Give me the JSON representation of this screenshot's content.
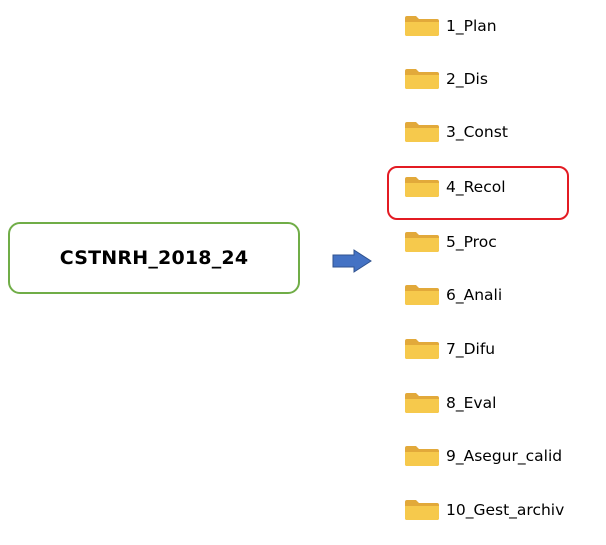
{
  "project": {
    "label": "CSTNRH_2018_24",
    "border_color": "#70ad47"
  },
  "arrow": {
    "icon": "arrow-right-icon",
    "color": "#4472c4"
  },
  "folder_icon": {
    "name": "folder-icon",
    "color": "#f6c94c"
  },
  "highlight": {
    "color": "#e31b23",
    "target": "4_Recol"
  },
  "folders": [
    {
      "label": "1_Plan"
    },
    {
      "label": "2_Dis"
    },
    {
      "label": "3_Const"
    },
    {
      "label": "4_Recol",
      "highlighted": true
    },
    {
      "label": "5_Proc"
    },
    {
      "label": "6_Anali"
    },
    {
      "label": "7_Difu"
    },
    {
      "label": "8_Eval"
    },
    {
      "label": "9_Asegur_calid"
    },
    {
      "label": "10_Gest_archiv"
    }
  ]
}
